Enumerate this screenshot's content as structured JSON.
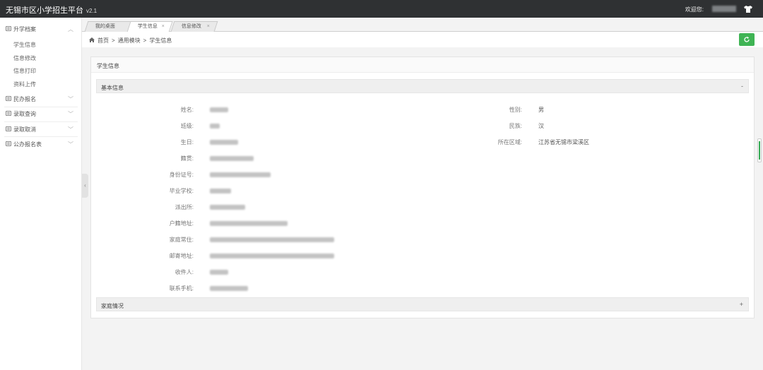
{
  "app": {
    "title": "无锡市区小学招生平台",
    "version": "v2.1"
  },
  "header": {
    "welcome": "欢迎您:"
  },
  "sidebar": {
    "groups": [
      {
        "label": "升学档案",
        "icon": "list-icon",
        "subitems": [
          "学生信息",
          "信息修改",
          "信息打印",
          "资料上传"
        ]
      },
      {
        "label": "民办报名",
        "icon": "list-icon"
      },
      {
        "label": "录取查询",
        "icon": "list-icon"
      },
      {
        "label": "录取取消",
        "icon": "list-icon"
      },
      {
        "label": "公办报名表",
        "icon": "list-icon"
      }
    ]
  },
  "tabs": [
    {
      "label": "我的桌面"
    },
    {
      "label": "学生信息",
      "close": "×",
      "active": true
    },
    {
      "label": "信息修改",
      "close": "×"
    }
  ],
  "breadcrumb": {
    "items": [
      "首页",
      ">",
      "通用模块",
      ">",
      "学生信息"
    ]
  },
  "card": {
    "title": "学生信息",
    "sections": [
      {
        "title": "基本信息",
        "toggle": "-"
      },
      {
        "title": "家庭情况",
        "toggle": "+"
      }
    ]
  },
  "fields_left": [
    {
      "label": "姓名:"
    },
    {
      "label": "班级:"
    },
    {
      "label": "生日:"
    },
    {
      "label": "籍贯:"
    },
    {
      "label": "身份证号:"
    },
    {
      "label": "毕业学校:"
    },
    {
      "label": "派出所:"
    },
    {
      "label": "户籍地址:"
    },
    {
      "label": "家庭常住:"
    },
    {
      "label": "邮寄地址:"
    },
    {
      "label": "收件人:"
    },
    {
      "label": "联系手机:"
    }
  ],
  "fields_right": [
    {
      "label": "性别:",
      "value": "男"
    },
    {
      "label": "民族:",
      "value": "汉"
    },
    {
      "label": "所在区域:",
      "value": "江苏省无锡市梁溪区"
    }
  ],
  "colors": {
    "topbar": "#2f3133",
    "accent_green": "#3fb454"
  }
}
